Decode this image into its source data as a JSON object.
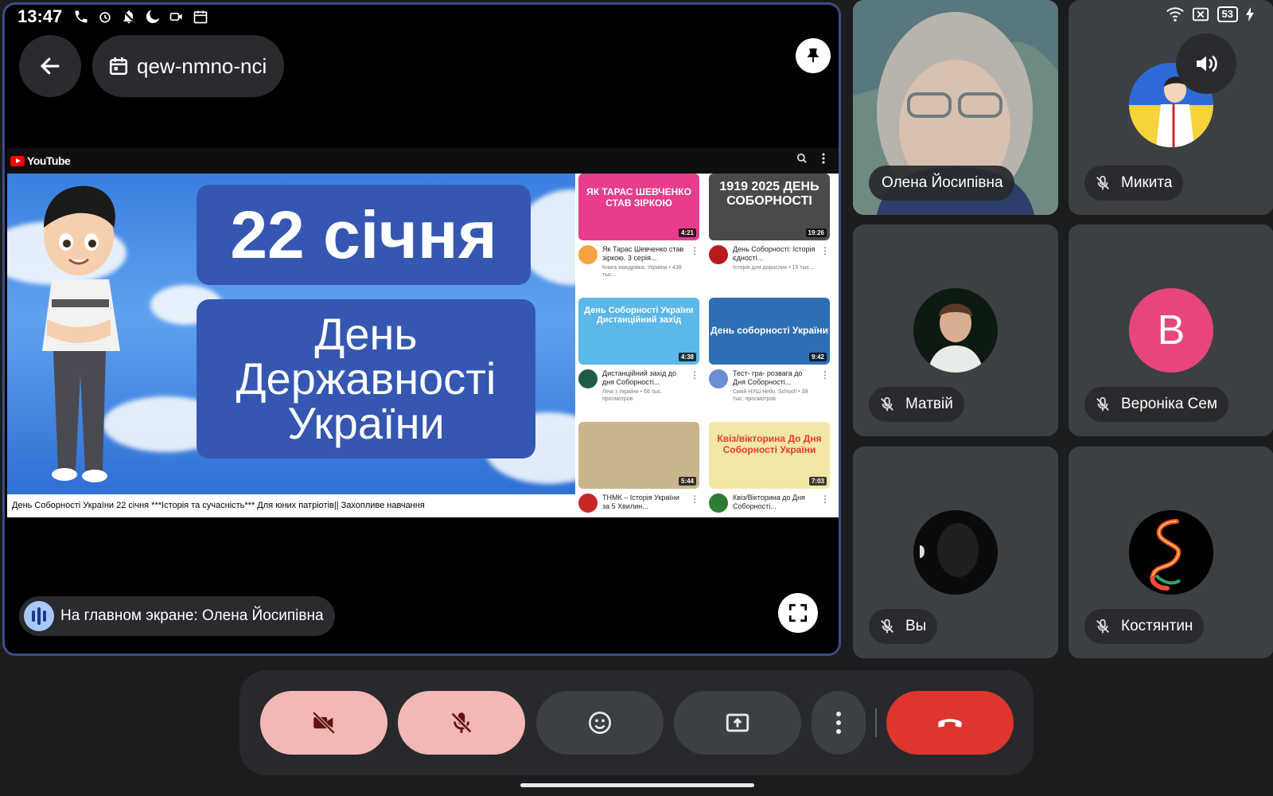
{
  "status_bar": {
    "time": "13:47",
    "battery": "53"
  },
  "meeting": {
    "code": "qew-nmno-nci"
  },
  "youtube": {
    "logo_text": "YouTube",
    "video": {
      "line1": "22 січня",
      "line2": "День",
      "line3": "Державності",
      "line4": "України",
      "caption": "День Соборності України 22 січня ***Історія та сучасність*** Для юних патріотів|| Захопливе навчання"
    },
    "recommendations": [
      {
        "thumb_text": "ЯК ТАРАС ШЕВЧЕНКО СТАВ ЗІРКОЮ",
        "duration": "4:21",
        "title": "Як Тарас Шевченко став зіркою. 3 серія...",
        "meta": "Книга мандрівка. Україна • 438 тыс...",
        "thumb_color": "#e73d8c",
        "avatar_color": "#f4a340"
      },
      {
        "thumb_text": "1919 2025 ДЕНЬ СОБОРНОСТІ",
        "duration": "19:26",
        "title": "День Соборності: Історія єдності...",
        "meta": "Історія для дорослих • 15 тыс...",
        "thumb_color": "#4a4a4a",
        "avatar_color": "#b71c1c"
      },
      {
        "thumb_text": "День Соборності України Дистанційний захід",
        "duration": "4:38",
        "title": "Дистанційний захід до дня Соборності...",
        "meta": "Ліна з України • 66 тыс. просмотров",
        "thumb_color": "#5bb8e8",
        "avatar_color": "#1e5c4a"
      },
      {
        "thumb_text": "День соборності України",
        "duration": "9:42",
        "title": "Тест- гра- розвага до Дня Соборності...",
        "meta": "Сквій НУШ Hello, School! • 39 тыс. просмотров",
        "thumb_color": "#2d6fb4",
        "avatar_color": "#6b8cd6"
      },
      {
        "thumb_text": "",
        "duration": "5:44",
        "title": "ТНМК – Історія України за 5 Хвилин...",
        "meta": "",
        "thumb_color": "#c9b58c",
        "avatar_color": "#c62828"
      },
      {
        "thumb_text": "Квіз/вікторина До Дня Соборності України",
        "duration": "7:03",
        "title": "Квіз/Вікторина до Дня Соборності...",
        "meta": "",
        "thumb_color": "#f3e7a6",
        "avatar_color": "#2e7d32"
      }
    ]
  },
  "spotlight": {
    "label": "На главном экране: Олена Йосипівна"
  },
  "participants": [
    {
      "name": "Олена Йосипівна",
      "muted": false,
      "kind": "video"
    },
    {
      "name": "Микита",
      "muted": true,
      "kind": "avatar"
    },
    {
      "name": "Матвій",
      "muted": true,
      "kind": "avatar"
    },
    {
      "name": "Вероніка Сем",
      "muted": true,
      "kind": "letter",
      "letter": "В",
      "color": "#e8457d"
    },
    {
      "name": "Вы",
      "muted": true,
      "kind": "avatar"
    },
    {
      "name": "Костянтин",
      "muted": true,
      "kind": "avatar"
    }
  ],
  "controls": {
    "camera": {
      "icon": "videocam-off-icon",
      "color": "#f2b8b5"
    },
    "mic": {
      "icon": "mic-off-icon",
      "color": "#f2b8b5"
    },
    "reactions": {
      "icon": "emoji-icon"
    },
    "present": {
      "icon": "present-screen-icon"
    },
    "more": {
      "icon": "more-vertical-icon"
    },
    "leave": {
      "icon": "call-end-icon",
      "color": "#dc362e"
    }
  }
}
